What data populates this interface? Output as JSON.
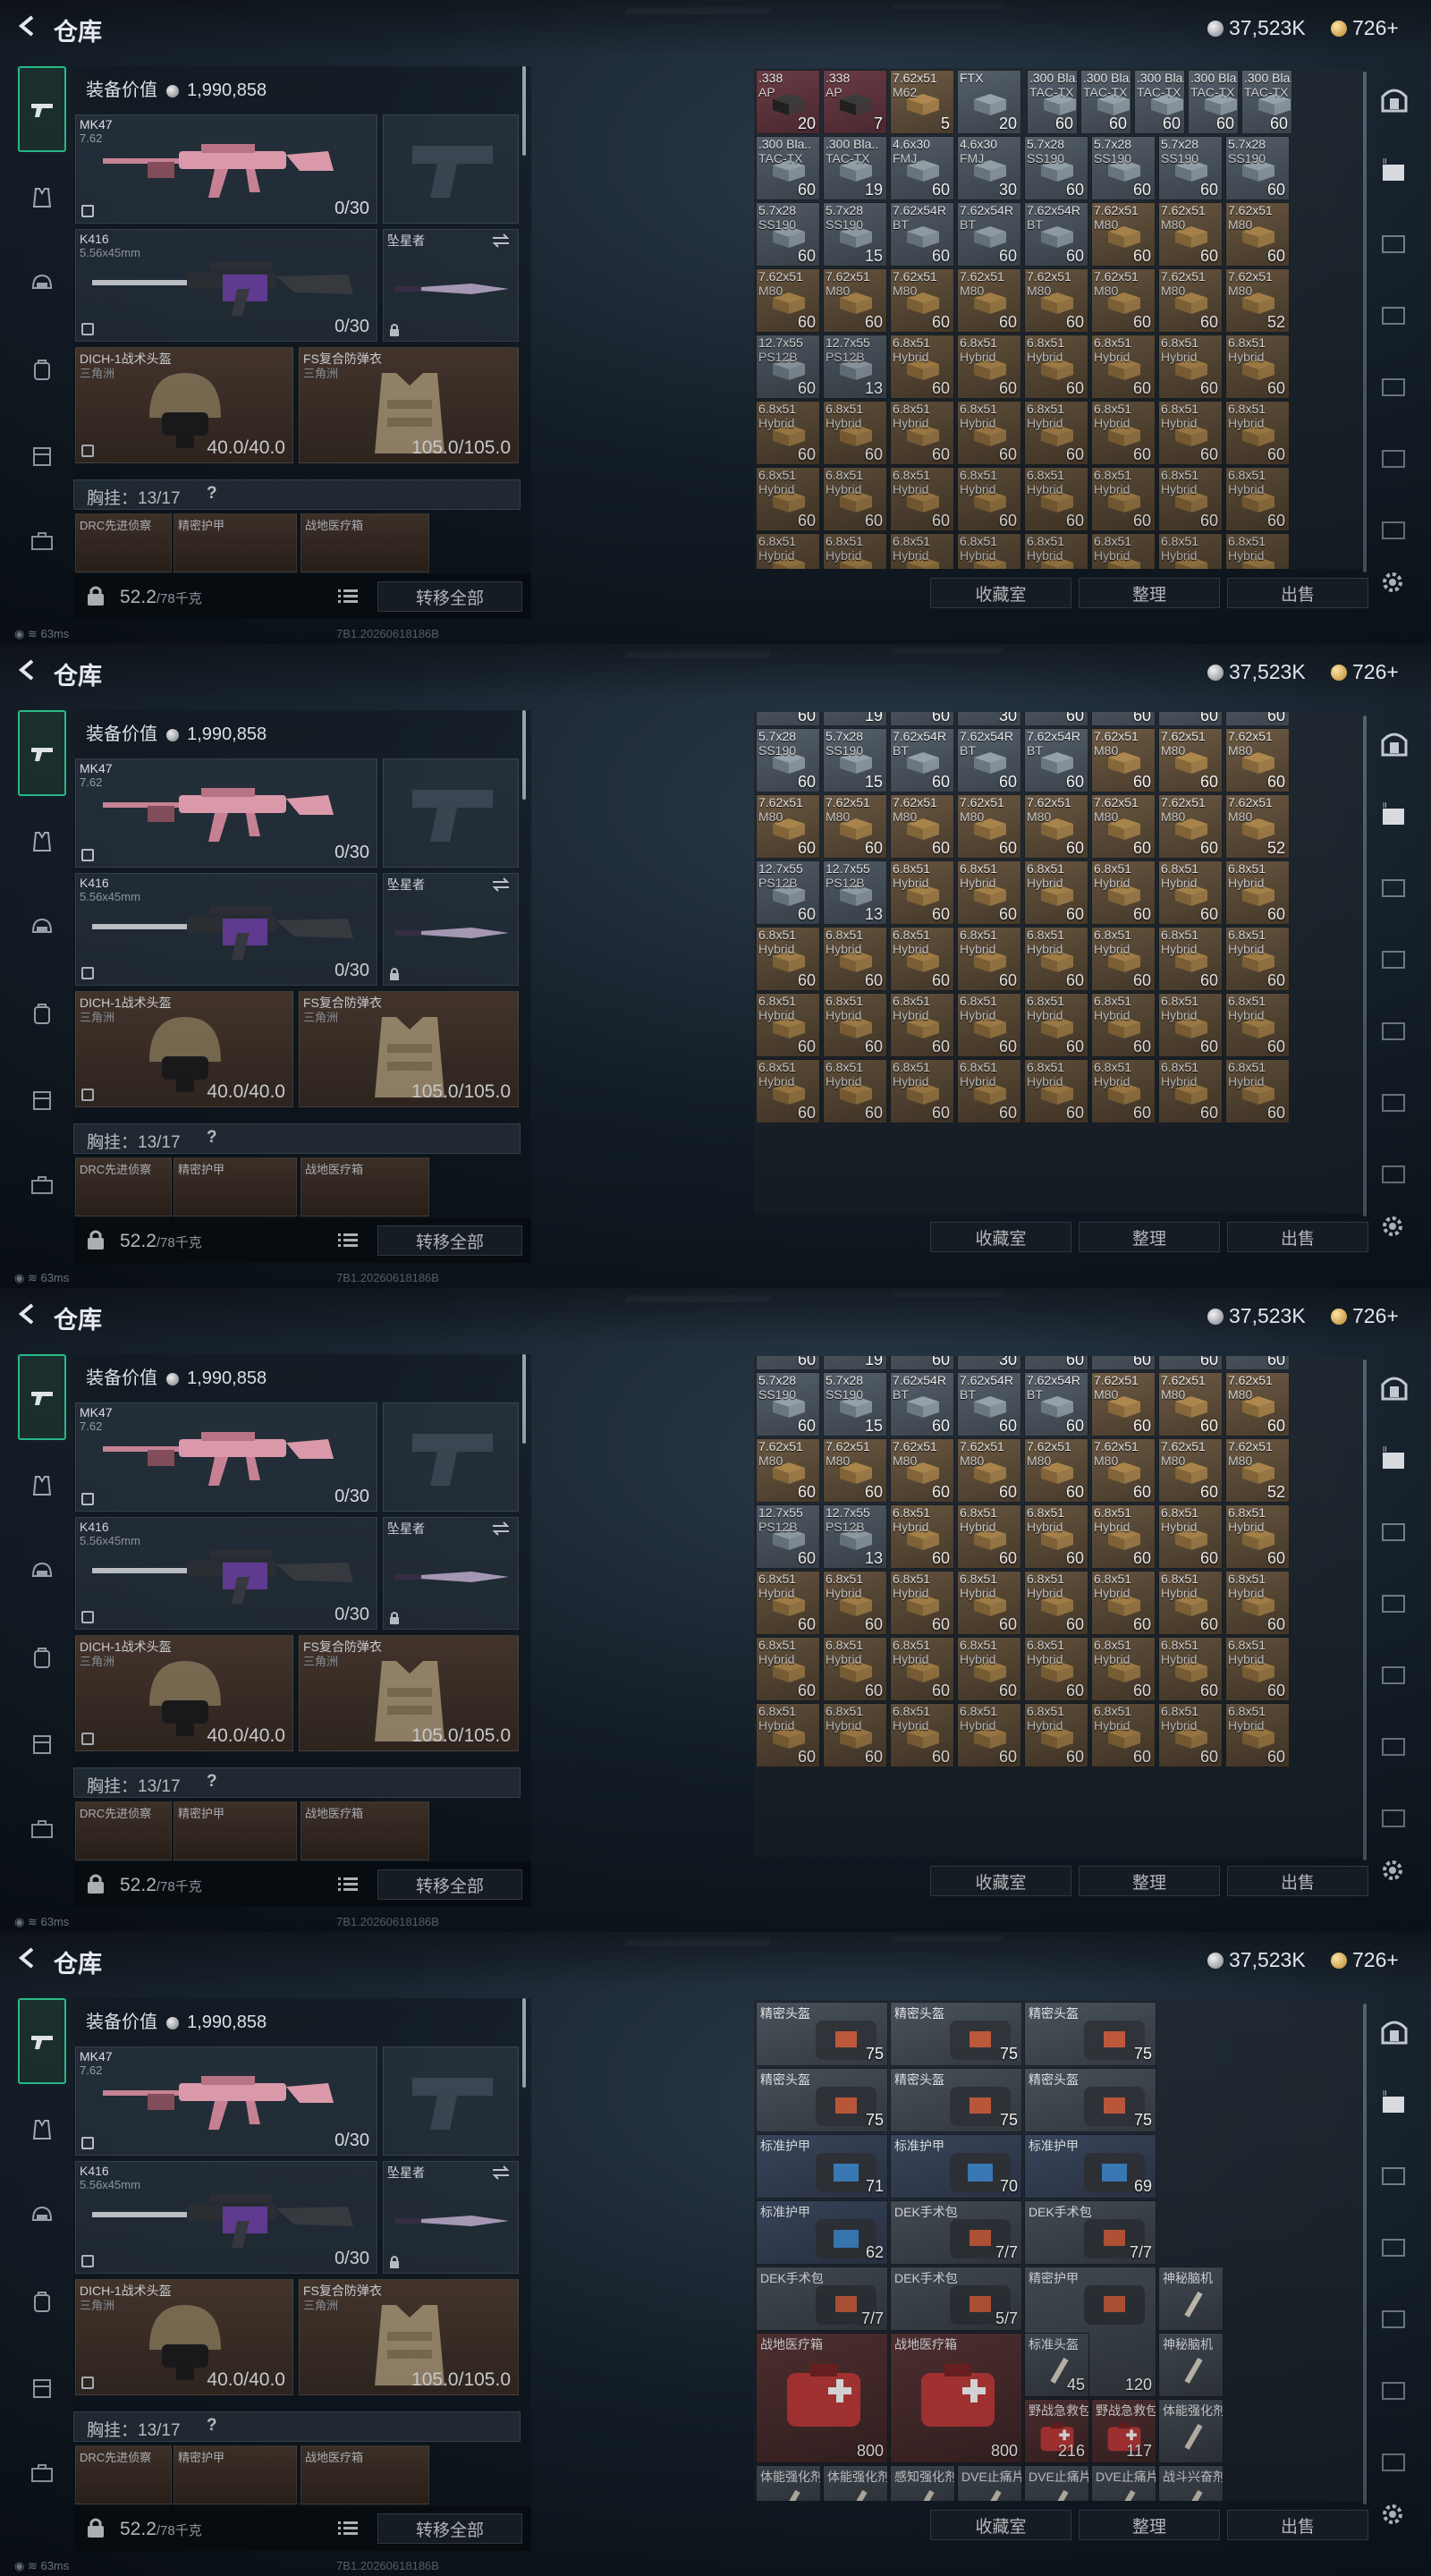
{
  "title": "仓库",
  "currency": {
    "silver": "37,523K",
    "gold": "726+"
  },
  "equipment": {
    "value_label": "装备价值",
    "value": "1,990,858",
    "primary": {
      "name": "MK47",
      "caliber": "7.62",
      "ammo": "0/30"
    },
    "secondary": {
      "name": "K416",
      "caliber": "5.56x45mm",
      "ammo": "0/30"
    },
    "melee": {
      "name": "坠星者"
    },
    "helmet": {
      "name": "DICH-1战术头盔",
      "sub": "三角洲",
      "durability": "40.0/40.0"
    },
    "armor": {
      "name": "FS复合防弹衣",
      "sub": "三角洲",
      "durability": "105.0/105.0"
    },
    "chest": {
      "label": "胸挂：13/17",
      "help": "?"
    },
    "mini_slots": [
      "DRC先进侦察",
      "精密护甲",
      "战地医疗箱"
    ],
    "weight": "52.2",
    "weight_unit": "/78千克",
    "transfer_label": "转移全部"
  },
  "buttons": {
    "collect": "收藏室",
    "sort": "整理",
    "sell": "出售"
  },
  "status": {
    "ping": "63ms",
    "version": "7B1.20260618186B"
  },
  "grid_ammo": {
    "row0": [
      {
        "n": ".338",
        "s": "AP",
        "c": "20",
        "t": "red"
      },
      {
        "n": ".338",
        "s": "AP",
        "c": "7",
        "t": "red"
      },
      {
        "n": "7.62x51",
        "s": "M62",
        "c": "5",
        "t": "brown"
      },
      {
        "n": "FTX",
        "s": "",
        "c": "20",
        "t": "grey"
      },
      {
        "n": ".300 Bla..",
        "s": "TAC-TX",
        "c": "60",
        "t": "grey"
      },
      {
        "n": ".300 Bla..",
        "s": "TAC-TX",
        "c": "60",
        "t": "grey"
      },
      {
        "n": ".300 Bla..",
        "s": "TAC-TX",
        "c": "60",
        "t": "grey"
      },
      {
        "n": ".300 Bla..",
        "s": "TAC-TX",
        "c": "60",
        "t": "grey"
      },
      {
        "n": ".300 Bla..",
        "s": "TAC-TX",
        "c": "60",
        "t": "grey"
      }
    ],
    "row1": [
      {
        "n": ".300 Bla..",
        "s": "TAC-TX",
        "c": "60",
        "t": "grey"
      },
      {
        "n": ".300 Bla..",
        "s": "TAC-TX",
        "c": "19",
        "t": "grey"
      },
      {
        "n": "4.6x30",
        "s": "FMJ",
        "c": "60",
        "t": "grey"
      },
      {
        "n": "4.6x30",
        "s": "FMJ",
        "c": "30",
        "t": "grey"
      },
      {
        "n": "5.7x28",
        "s": "SS190",
        "c": "60",
        "t": "grey"
      },
      {
        "n": "5.7x28",
        "s": "SS190",
        "c": "60",
        "t": "grey"
      },
      {
        "n": "5.7x28",
        "s": "SS190",
        "c": "60",
        "t": "grey"
      },
      {
        "n": "5.7x28",
        "s": "SS190",
        "c": "60",
        "t": "grey"
      }
    ],
    "row2": [
      {
        "n": "5.7x28",
        "s": "SS190",
        "c": "60",
        "t": "grey"
      },
      {
        "n": "5.7x28",
        "s": "SS190",
        "c": "15",
        "t": "grey"
      },
      {
        "n": "7.62x54R",
        "s": "BT",
        "c": "60",
        "t": "grey"
      },
      {
        "n": "7.62x54R",
        "s": "BT",
        "c": "60",
        "t": "grey"
      },
      {
        "n": "7.62x54R",
        "s": "BT",
        "c": "60",
        "t": "grey"
      },
      {
        "n": "7.62x51",
        "s": "M80",
        "c": "60",
        "t": "brown"
      },
      {
        "n": "7.62x51",
        "s": "M80",
        "c": "60",
        "t": "brown"
      },
      {
        "n": "7.62x51",
        "s": "M80",
        "c": "60",
        "t": "brown"
      }
    ],
    "row3": [
      {
        "n": "7.62x51",
        "s": "M80",
        "c": "60",
        "t": "brown"
      },
      {
        "n": "7.62x51",
        "s": "M80",
        "c": "60",
        "t": "brown"
      },
      {
        "n": "7.62x51",
        "s": "M80",
        "c": "60",
        "t": "brown"
      },
      {
        "n": "7.62x51",
        "s": "M80",
        "c": "60",
        "t": "brown"
      },
      {
        "n": "7.62x51",
        "s": "M80",
        "c": "60",
        "t": "brown"
      },
      {
        "n": "7.62x51",
        "s": "M80",
        "c": "60",
        "t": "brown"
      },
      {
        "n": "7.62x51",
        "s": "M80",
        "c": "60",
        "t": "brown"
      },
      {
        "n": "7.62x51",
        "s": "M80",
        "c": "52",
        "t": "brown"
      }
    ],
    "row4": [
      {
        "n": "12.7x55",
        "s": "PS12B",
        "c": "60",
        "t": "grey"
      },
      {
        "n": "12.7x55",
        "s": "PS12B",
        "c": "13",
        "t": "grey"
      },
      {
        "n": "6.8x51",
        "s": "Hybrid",
        "c": "60",
        "t": "brown"
      },
      {
        "n": "6.8x51",
        "s": "Hybrid",
        "c": "60",
        "t": "brown"
      },
      {
        "n": "6.8x51",
        "s": "Hybrid",
        "c": "60",
        "t": "brown"
      },
      {
        "n": "6.8x51",
        "s": "Hybrid",
        "c": "60",
        "t": "brown"
      },
      {
        "n": "6.8x51",
        "s": "Hybrid",
        "c": "60",
        "t": "brown"
      },
      {
        "n": "6.8x51",
        "s": "Hybrid",
        "c": "60",
        "t": "brown"
      }
    ],
    "row_hybrid": {
      "n": "6.8x51",
      "s": "Hybrid",
      "c": "60",
      "t": "brown"
    }
  },
  "grid_med": [
    {
      "n": "精密头盔",
      "v": "75",
      "k": "grey",
      "col": 0,
      "row": 0,
      "w": 2,
      "h": 1
    },
    {
      "n": "精密头盔",
      "v": "75",
      "k": "grey",
      "col": 2,
      "row": 0,
      "w": 2,
      "h": 1
    },
    {
      "n": "精密头盔",
      "v": "75",
      "k": "grey",
      "col": 4,
      "row": 0,
      "w": 2,
      "h": 1
    },
    {
      "n": "精密头盔",
      "v": "75",
      "k": "grey",
      "col": 0,
      "row": 1,
      "w": 2,
      "h": 1
    },
    {
      "n": "精密头盔",
      "v": "75",
      "k": "grey",
      "col": 2,
      "row": 1,
      "w": 2,
      "h": 1
    },
    {
      "n": "精密头盔",
      "v": "75",
      "k": "grey",
      "col": 4,
      "row": 1,
      "w": 2,
      "h": 1
    },
    {
      "n": "标准护甲",
      "v": "71",
      "k": "blue",
      "col": 0,
      "row": 2,
      "w": 2,
      "h": 1
    },
    {
      "n": "标准护甲",
      "v": "70",
      "k": "blue",
      "col": 2,
      "row": 2,
      "w": 2,
      "h": 1
    },
    {
      "n": "标准护甲",
      "v": "69",
      "k": "blue",
      "col": 4,
      "row": 2,
      "w": 2,
      "h": 1
    },
    {
      "n": "标准护甲",
      "v": "62",
      "k": "blue",
      "col": 0,
      "row": 3,
      "w": 2,
      "h": 1
    },
    {
      "n": "DEK手术包",
      "v": "7/7",
      "k": "grey",
      "col": 2,
      "row": 3,
      "w": 2,
      "h": 1
    },
    {
      "n": "DEK手术包",
      "v": "7/7",
      "k": "grey",
      "col": 4,
      "row": 3,
      "w": 2,
      "h": 1
    },
    {
      "n": "DEK手术包",
      "v": "7/7",
      "k": "grey",
      "col": 0,
      "row": 4,
      "w": 2,
      "h": 1
    },
    {
      "n": "DEK手术包",
      "v": "5/7",
      "k": "grey",
      "col": 2,
      "row": 4,
      "w": 2,
      "h": 1
    },
    {
      "n": "精密护甲",
      "v": "120",
      "k": "grey",
      "col": 4,
      "row": 4,
      "w": 2,
      "h": 2
    },
    {
      "n": "神秘脑机",
      "v": "",
      "k": "grey",
      "col": 6,
      "row": 4,
      "w": 1,
      "h": 1
    },
    {
      "n": "战地医疗箱",
      "v": "800",
      "k": "red",
      "col": 0,
      "row": 5,
      "w": 2,
      "h": 2
    },
    {
      "n": "战地医疗箱",
      "v": "800",
      "k": "red",
      "col": 2,
      "row": 5,
      "w": 2,
      "h": 2
    },
    {
      "n": "标准头盔",
      "v": "45",
      "k": "grey",
      "col": 4,
      "row": 5,
      "w": 1,
      "h": 1
    },
    {
      "n": "神秘脑机",
      "v": "",
      "k": "grey",
      "col": 6,
      "row": 5,
      "w": 1,
      "h": 1
    },
    {
      "n": "野战急救包",
      "v": "216",
      "k": "red",
      "col": 4,
      "row": 6,
      "w": 1,
      "h": 1
    },
    {
      "n": "野战急救包",
      "v": "117",
      "k": "red",
      "col": 5,
      "row": 6,
      "w": 1,
      "h": 1
    },
    {
      "n": "体能强化剂",
      "v": "",
      "k": "grey",
      "col": 6,
      "row": 6,
      "w": 1,
      "h": 1
    },
    {
      "n": "体能强化剂",
      "v": "",
      "k": "grey",
      "col": 0,
      "row": 7,
      "w": 1,
      "h": 1
    },
    {
      "n": "体能强化剂",
      "v": "",
      "k": "grey",
      "col": 1,
      "row": 7,
      "w": 1,
      "h": 1
    },
    {
      "n": "感知强化剂",
      "v": "",
      "k": "grey",
      "col": 2,
      "row": 7,
      "w": 1,
      "h": 1
    },
    {
      "n": "DVE止痛片",
      "v": "",
      "k": "grey",
      "col": 3,
      "row": 7,
      "w": 1,
      "h": 1
    },
    {
      "n": "DVE止痛片",
      "v": "",
      "k": "grey",
      "col": 4,
      "row": 7,
      "w": 1,
      "h": 1
    },
    {
      "n": "DVE止痛片",
      "v": "",
      "k": "grey",
      "col": 5,
      "row": 7,
      "w": 1,
      "h": 1
    },
    {
      "n": "战斗兴奋剂",
      "v": "",
      "k": "grey",
      "col": 6,
      "row": 7,
      "w": 1,
      "h": 1
    }
  ]
}
